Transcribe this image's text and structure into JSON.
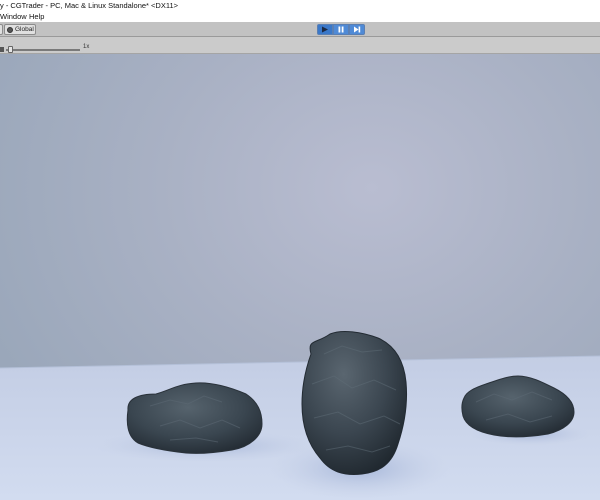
{
  "window": {
    "title": "y - CGTrader - PC, Mac & Linux Standalone* <DX11>"
  },
  "menu": {
    "items": [
      "Window",
      "Help"
    ]
  },
  "toolbar": {
    "pivot_rotation_label": "Global",
    "play_controls": [
      {
        "name": "play",
        "icon": "play-icon",
        "state": "active"
      },
      {
        "name": "pause",
        "icon": "pause-icon",
        "state": "normal"
      },
      {
        "name": "step",
        "icon": "step-icon",
        "state": "normal"
      }
    ]
  },
  "scene_toolbar": {
    "slider_value_label": "1x",
    "slider_level": 0.05
  },
  "viewport": {
    "objects": [
      "rock",
      "rock",
      "rock"
    ],
    "colors": {
      "sky": "#a9b1c4",
      "floor": "#c7d3ea",
      "rock": "#3b464f",
      "accent": "#3a78c9"
    }
  }
}
